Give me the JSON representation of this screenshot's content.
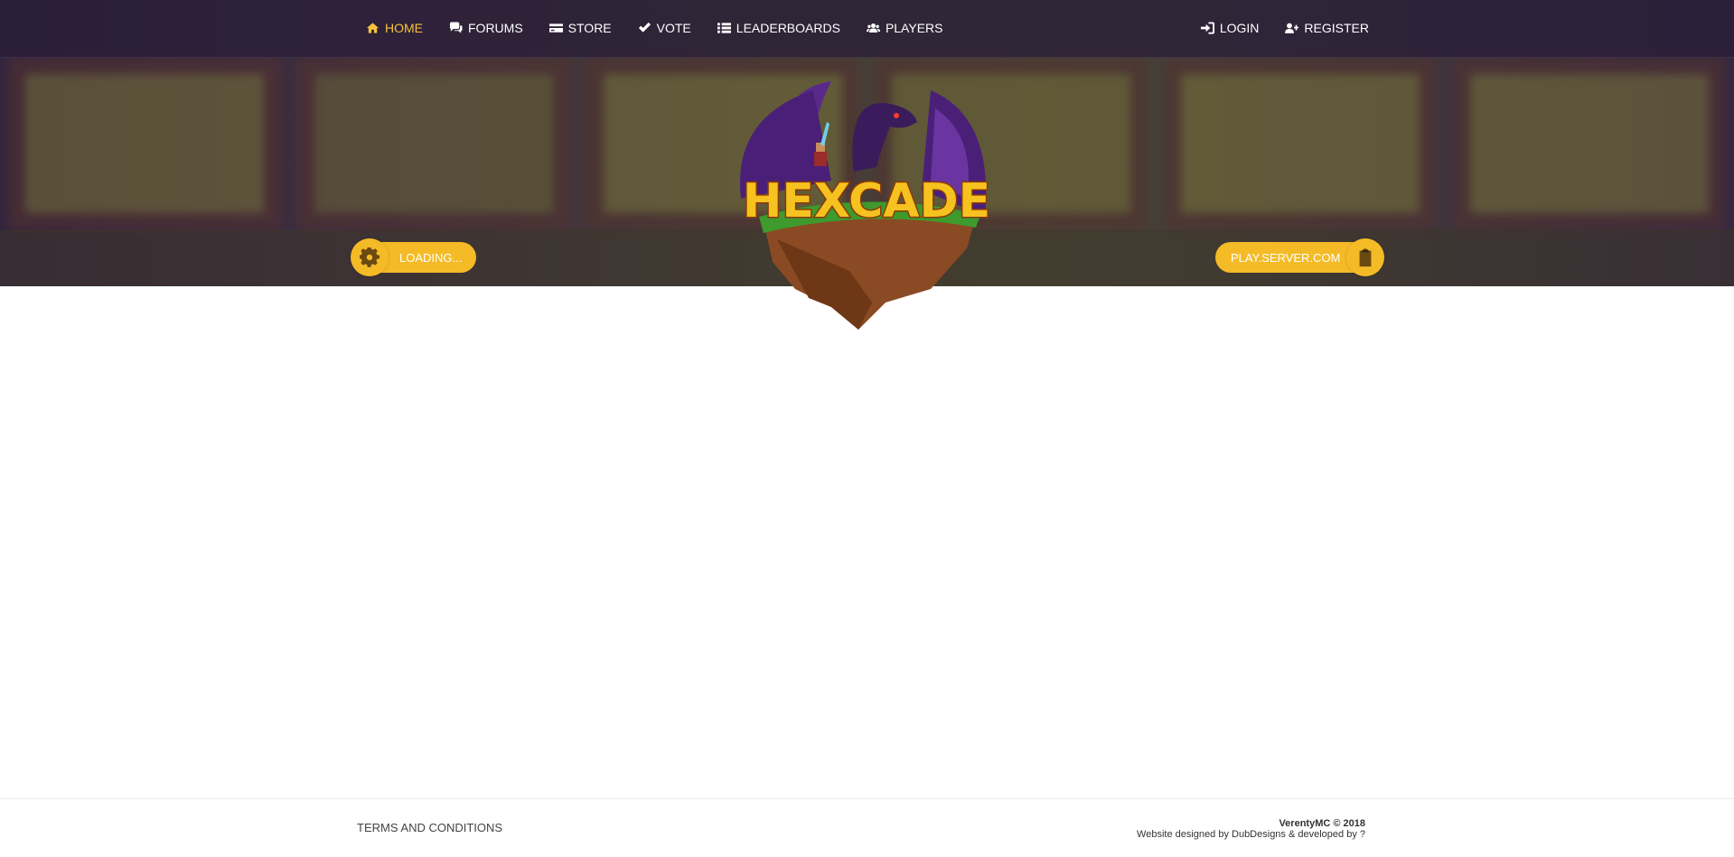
{
  "nav": {
    "left": [
      {
        "label": "HOME",
        "icon": "home-icon",
        "active": true
      },
      {
        "label": "FORUMS",
        "icon": "comments-icon"
      },
      {
        "label": "STORE",
        "icon": "credit-card-icon"
      },
      {
        "label": "VOTE",
        "icon": "check-icon"
      },
      {
        "label": "LEADERBOARDS",
        "icon": "list-icon"
      },
      {
        "label": "PLAYERS",
        "icon": "users-icon"
      }
    ],
    "right": [
      {
        "label": "LOGIN",
        "icon": "sign-in-icon"
      },
      {
        "label": "REGISTER",
        "icon": "user-plus-icon"
      }
    ]
  },
  "hero": {
    "status_label": "LOADING...",
    "status_icon": "gear-icon",
    "server_ip": "PLAY.SERVER.COM",
    "copy_icon": "clipboard-icon",
    "logo_text": "HEXCADE"
  },
  "footer": {
    "terms_label": "TERMS AND CONDITIONS",
    "copyright": "VerentyMC © 2018",
    "credits": "Website designed by DubDesigns & developed by ?"
  },
  "colors": {
    "accent": "#f4bb27",
    "active_nav": "#f6c23d",
    "nav_background": "#2e2340"
  }
}
